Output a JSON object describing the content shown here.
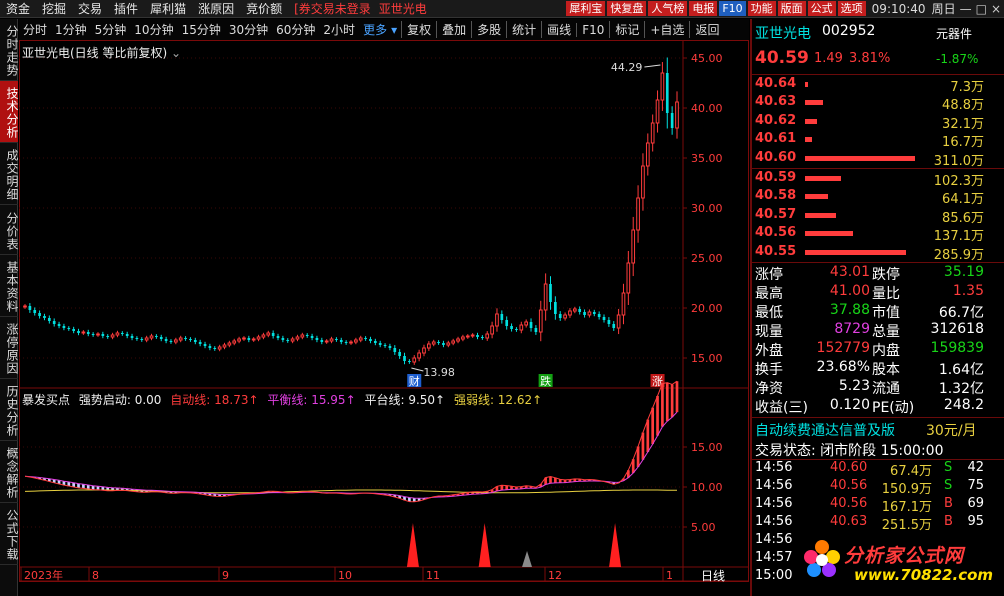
{
  "menu": {
    "items": [
      "资金",
      "挖掘",
      "交易",
      "插件",
      "犀利猫",
      "涨原因",
      "竞价额"
    ],
    "login_warning": "[券交易未登录",
    "stock_name": "亚世光电",
    "right_buttons": [
      "犀利宝",
      "快复盘",
      "人气榜",
      "电报",
      "F10",
      "功能",
      "版面",
      "公式",
      "选项"
    ],
    "time": "09:10:40",
    "weekday": "周日"
  },
  "sidebar": {
    "tabs": [
      "分时走势",
      "技术分析",
      "成交明细",
      "分价表",
      "基本资料",
      "涨停原因",
      "历史分析",
      "概念解析",
      "公式下载"
    ],
    "active_index": 1
  },
  "periods": {
    "items": [
      "分时",
      "1分钟",
      "5分钟",
      "10分钟",
      "15分钟",
      "30分钟",
      "60分钟",
      "2小时"
    ],
    "more": "更多",
    "tools": [
      "复权",
      "叠加",
      "多股",
      "统计",
      "画线",
      "F10",
      "标记",
      "+自选",
      "返回"
    ]
  },
  "chart_header": {
    "title": "亚世光电(日线 等比前复权)"
  },
  "indicator_line": {
    "name": "暴发买点",
    "strong_label": "强势启动: 0.00",
    "auto_label": "自动线: 18.73↑",
    "balance_label": "平衡线: 15.95↑",
    "platform_label": "平台线: 9.50↑",
    "weak_label": "强弱线: 12.62↑"
  },
  "chart_data": [
    {
      "type": "candlestick",
      "title": "亚世光电(日线 等比前复权)",
      "ylim": [
        12,
        46
      ],
      "y_ticks": [
        "45.00",
        "40.00",
        "35.00",
        "30.00",
        "25.00",
        "20.00",
        "15.00"
      ],
      "x_ticks": [
        "2023年",
        "8",
        "9",
        "10",
        "11",
        "12",
        "1"
      ],
      "annotations": [
        {
          "text": "44.29",
          "at": "high"
        },
        {
          "text": "13.98",
          "at": "low"
        }
      ],
      "markers": [
        "财",
        "跌",
        "涨"
      ],
      "close": [
        20.2,
        19.8,
        19.5,
        19.2,
        19.0,
        18.7,
        18.4,
        18.2,
        18.0,
        17.9,
        17.7,
        17.5,
        17.6,
        17.4,
        17.3,
        17.4,
        17.2,
        17.1,
        17.3,
        17.5,
        17.4,
        17.2,
        17.0,
        16.9,
        16.8,
        17.0,
        17.2,
        17.1,
        16.9,
        16.7,
        16.6,
        16.8,
        17.0,
        16.9,
        16.8,
        16.6,
        16.4,
        16.2,
        16.0,
        15.9,
        16.1,
        16.3,
        16.5,
        16.7,
        16.9,
        17.0,
        16.8,
        16.9,
        17.1,
        17.3,
        17.5,
        17.2,
        17.0,
        16.8,
        16.7,
        16.9,
        17.1,
        17.3,
        17.2,
        17.0,
        16.8,
        16.6,
        16.7,
        16.9,
        16.8,
        16.6,
        16.5,
        16.6,
        16.8,
        17.0,
        16.9,
        16.7,
        16.5,
        16.3,
        16.2,
        16.0,
        15.6,
        15.2,
        14.7,
        14.6,
        15.0,
        15.5,
        16.0,
        16.4,
        16.6,
        16.5,
        16.3,
        16.5,
        16.7,
        16.9,
        17.1,
        17.2,
        17.3,
        17.1,
        17.0,
        17.4,
        18.2,
        19.4,
        18.8,
        18.2,
        17.9,
        17.8,
        18.3,
        18.6,
        18.0,
        17.6,
        19.8,
        22.4,
        20.6,
        19.4,
        19.0,
        19.3,
        19.7,
        19.9,
        19.6,
        19.3,
        19.6,
        19.4,
        19.1,
        18.8,
        18.4,
        18.0,
        19.3,
        21.5,
        24.5,
        27.8,
        31.0,
        34.2,
        36.5,
        38.5,
        40.8,
        43.5,
        39.5,
        38.0,
        40.6
      ],
      "series": [
        {
          "name": "强势启动",
          "value": 0.0
        },
        {
          "name": "自动线",
          "value": 18.73
        },
        {
          "name": "平衡线",
          "value": 15.95
        },
        {
          "name": "平台线",
          "value": 9.5
        },
        {
          "name": "强弱线",
          "value": 12.62
        }
      ],
      "indicator_ylim": [
        0,
        20
      ],
      "indicator_y_ticks": [
        "15.00",
        "10.00",
        "5.00"
      ]
    }
  ],
  "colors": {
    "up": "#ff3c3c",
    "down": "#00e0e0",
    "bg": "#000000",
    "frame": "#7a0a0a"
  },
  "quote": {
    "name": "亚世光电",
    "code": "002952",
    "sector": "元器件",
    "sector_change": "-1.87%",
    "price": "40.59",
    "change": "1.49",
    "change_pct": "3.81%"
  },
  "asks": [
    {
      "price": "40.64",
      "vol": "7.3万",
      "frac": 0.02
    },
    {
      "price": "40.63",
      "vol": "48.8万",
      "frac": 0.16
    },
    {
      "price": "40.62",
      "vol": "32.1万",
      "frac": 0.11
    },
    {
      "price": "40.61",
      "vol": "16.7万",
      "frac": 0.06
    },
    {
      "price": "40.60",
      "vol": "311.0万",
      "frac": 1.0
    }
  ],
  "bids": [
    {
      "price": "40.59",
      "vol": "102.3万",
      "frac": 0.33
    },
    {
      "price": "40.58",
      "vol": "64.1万",
      "frac": 0.21
    },
    {
      "price": "40.57",
      "vol": "85.6万",
      "frac": 0.28
    },
    {
      "price": "40.56",
      "vol": "137.1万",
      "frac": 0.44
    },
    {
      "price": "40.55",
      "vol": "285.9万",
      "frac": 0.92
    }
  ],
  "stats": [
    {
      "l1": "涨停",
      "v1": "43.01",
      "c1": "red",
      "l2": "跌停",
      "v2": "35.19",
      "c2": "green"
    },
    {
      "l1": "最高",
      "v1": "41.00",
      "c1": "red",
      "l2": "量比",
      "v2": "1.35",
      "c2": "red"
    },
    {
      "l1": "最低",
      "v1": "37.88",
      "c1": "green",
      "l2": "市值",
      "v2": "66.7亿",
      "c2": "white"
    },
    {
      "l1": "现量",
      "v1": "8729",
      "c1": "mag",
      "l2": "总量",
      "v2": "312618",
      "c2": "white"
    },
    {
      "l1": "外盘",
      "v1": "152779",
      "c1": "red",
      "l2": "内盘",
      "v2": "159839",
      "c2": "green"
    },
    {
      "l1": "换手",
      "v1": "23.68%",
      "c1": "white",
      "l2": "股本",
      "v2": "1.64亿",
      "c2": "white"
    },
    {
      "l1": "净资",
      "v1": "5.23",
      "c1": "white",
      "l2": "流通",
      "v2": "1.32亿",
      "c2": "white"
    },
    {
      "l1": "收益(三)",
      "v1": "0.120",
      "c1": "white",
      "l2": "PE(动)",
      "v2": "248.2",
      "c2": "white"
    }
  ],
  "promo": {
    "text": "自动续费通达信普及版",
    "price": "30元/月"
  },
  "trade_status": "交易状态: 闭市阶段 15:00:00",
  "ticks": [
    {
      "time": "14:56",
      "price": "40.60",
      "vol": "67.4万",
      "side": "S",
      "n": "42"
    },
    {
      "time": "14:56",
      "price": "40.56",
      "vol": "150.9万",
      "side": "S",
      "n": "75"
    },
    {
      "time": "14:56",
      "price": "40.56",
      "vol": "167.1万",
      "side": "B",
      "n": "69"
    },
    {
      "time": "14:56",
      "price": "40.63",
      "vol": "251.5万",
      "side": "B",
      "n": "95"
    },
    {
      "time": "14:56",
      "price": "",
      "vol": "",
      "side": "",
      "n": ""
    },
    {
      "time": "14:57",
      "price": "",
      "vol": "",
      "side": "",
      "n": ""
    },
    {
      "time": "15:00",
      "price": "",
      "vol": "",
      "side": "",
      "n": ""
    }
  ],
  "bottom_label": "日线",
  "logo": {
    "text": "分析家公式网",
    "url": "www.70822.com"
  }
}
